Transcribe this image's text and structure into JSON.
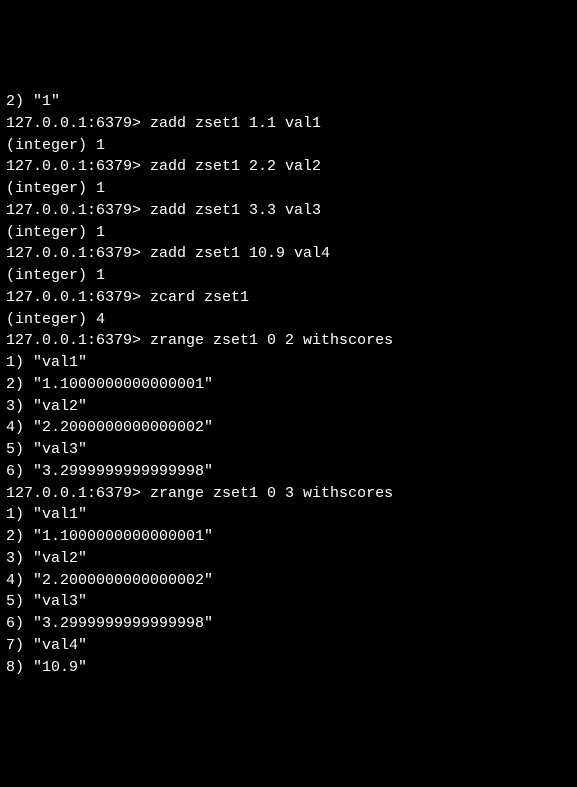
{
  "prompt": "127.0.0.1:6379>",
  "block0_result": "2) \"1\"",
  "blocks": [
    {
      "command": "zadd zset1 1.1 val1",
      "results": [
        "(integer) 1"
      ]
    },
    {
      "command": "zadd zset1 2.2 val2",
      "results": [
        "(integer) 1"
      ]
    },
    {
      "command": "zadd zset1 3.3 val3",
      "results": [
        "(integer) 1"
      ]
    },
    {
      "command": "zadd zset1 10.9 val4",
      "results": [
        "(integer) 1"
      ]
    },
    {
      "command": "zcard zset1",
      "results": [
        "(integer) 4"
      ]
    },
    {
      "command": "zrange zset1 0 2 withscores",
      "results": [
        "1) \"val1\"",
        "2) \"1.1000000000000001\"",
        "3) \"val2\"",
        "4) \"2.2000000000000002\"",
        "5) \"val3\"",
        "6) \"3.2999999999999998\""
      ]
    },
    {
      "command": "zrange zset1 0 3 withscores",
      "results": [
        "1) \"val1\"",
        "2) \"1.1000000000000001\"",
        "3) \"val2\"",
        "4) \"2.2000000000000002\"",
        "5) \"val3\"",
        "6) \"3.2999999999999998\"",
        "7) \"val4\"",
        "8) \"10.9\""
      ]
    }
  ]
}
